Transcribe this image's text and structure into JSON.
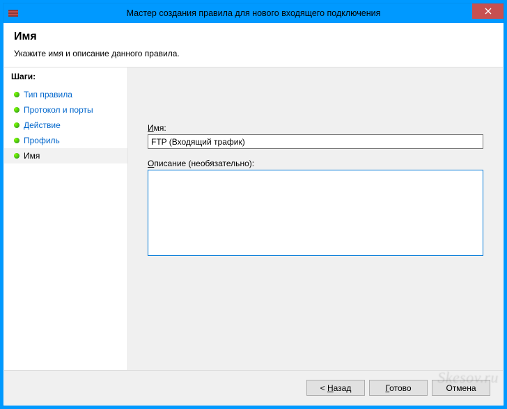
{
  "titlebar": {
    "title": "Мастер создания правила для нового входящего подключения"
  },
  "header": {
    "title": "Имя",
    "subtitle": "Укажите имя и описание данного правила."
  },
  "sidebar": {
    "steps_label": "Шаги:",
    "items": [
      {
        "label": "Тип правила",
        "current": false
      },
      {
        "label": "Протокол и порты",
        "current": false
      },
      {
        "label": "Действие",
        "current": false
      },
      {
        "label": "Профиль",
        "current": false
      },
      {
        "label": "Имя",
        "current": true
      }
    ]
  },
  "form": {
    "name_prefix": "И",
    "name_rest": "мя:",
    "name_value": "FTP (Входящий трафик)",
    "desc_prefix": "О",
    "desc_rest": "писание (необязательно):",
    "desc_value": ""
  },
  "footer": {
    "back_prefix": "< ",
    "back_u": "Н",
    "back_rest": "азад",
    "finish_u": "Г",
    "finish_rest": "отово",
    "cancel": "Отмена"
  },
  "watermark": "Skesov.ru"
}
